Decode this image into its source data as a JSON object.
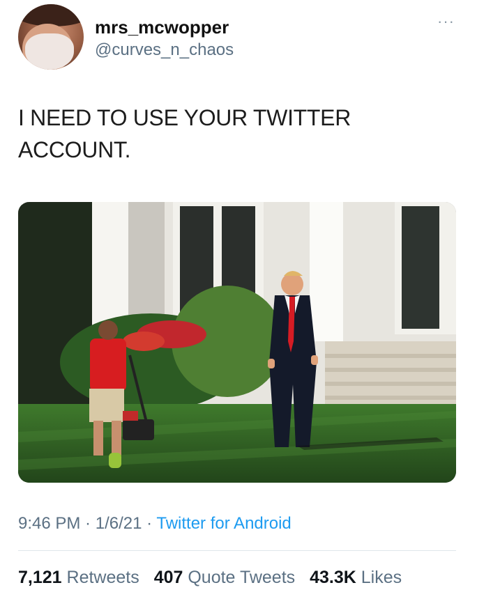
{
  "user": {
    "display_name": "mrs_mcwopper",
    "handle": "@curves_n_chaos"
  },
  "menu": {
    "more_label": "···"
  },
  "tweet": {
    "line1": "I NEED TO USE YOUR TWITTER",
    "line2": "ACCOUNT."
  },
  "meta": {
    "time": "9:46 PM",
    "sep1": " · ",
    "date": "1/6/21",
    "sep2": " · ",
    "source": "Twitter for Android"
  },
  "stats": {
    "retweets_count": "7,121",
    "retweets_label": "Retweets",
    "quotes_count": "407",
    "quotes_label": "Quote Tweets",
    "likes_count": "43.3K",
    "likes_label": "Likes"
  },
  "colors": {
    "link": "#1d9bf0",
    "secondary_text": "#5b7083",
    "primary_text": "#0f1419"
  }
}
